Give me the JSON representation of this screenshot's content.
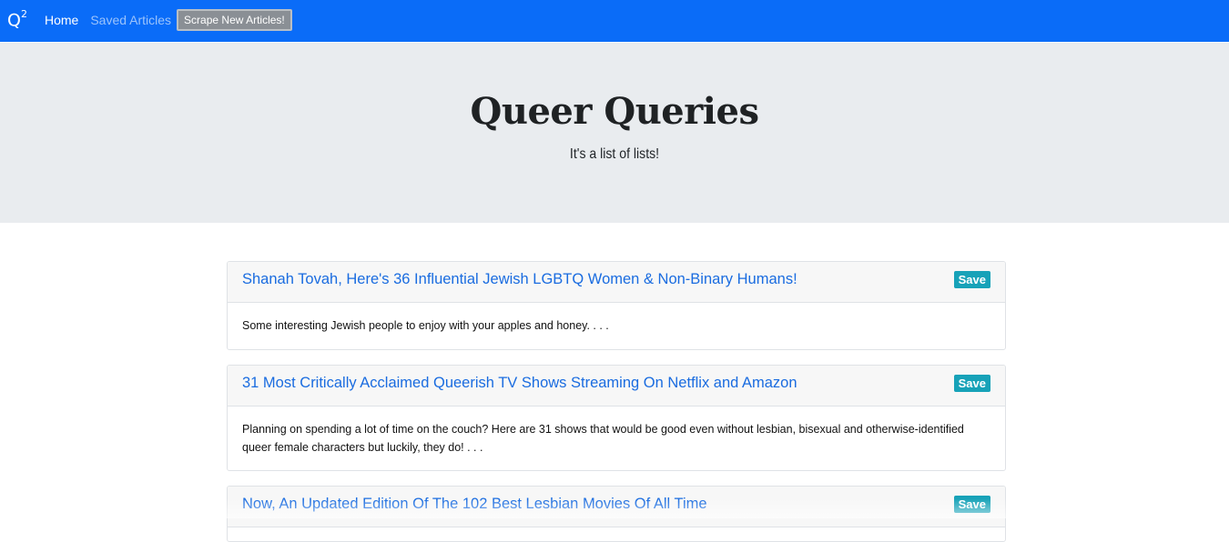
{
  "navbar": {
    "brand": "Q",
    "brand_sup": "2",
    "links": [
      "Home",
      "Saved Articles"
    ],
    "scrape_label": "Scrape New Articles!",
    "color": "#0a6cf8"
  },
  "hero": {
    "title": "Queer Queries",
    "subtitle": "It's a list of lists!"
  },
  "articles": [
    {
      "title": "Shanah Tovah, Here's 36 Influential Jewish LGBTQ Women & Non-Binary Humans!",
      "summary": "Some interesting Jewish people to enjoy with your apples and honey. . . .",
      "save_label": "Save"
    },
    {
      "title": "31 Most Critically Acclaimed Queerish TV Shows Streaming On Netflix and Amazon",
      "summary": "Planning on spending a lot of time on the couch? Here are 31 shows that would be good even without lesbian, bisexual and otherwise-identified queer female characters but luckily, they do! . . .",
      "save_label": "Save"
    },
    {
      "title": "Now, An Updated Edition Of The 102 Best Lesbian Movies Of All Time",
      "summary": "",
      "save_label": "Save"
    }
  ],
  "colors": {
    "save_button": "#17a2b8",
    "link": "#1a6ce0",
    "jumbotron": "#e9ecef"
  }
}
